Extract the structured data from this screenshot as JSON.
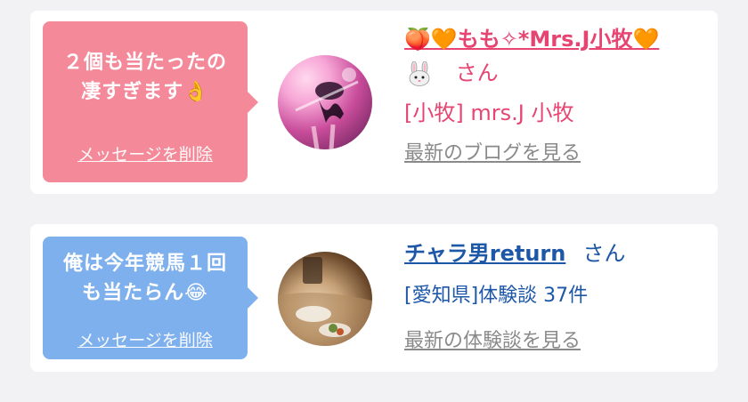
{
  "messages": [
    {
      "bubble_text_line1": "２個も当たったの",
      "bubble_text_line2": "凄すぎます👌",
      "delete_label": "メッセージを削除",
      "user_name": "🍑🧡もも✧*Mrs.J小牧🧡",
      "honorific": "さん",
      "subtitle": "[小牧] mrs.J 小牧",
      "link_label": "最新のブログを見る",
      "bubble_color": "#f4899a",
      "accent_color": "#e64572",
      "avatar_icon": "rabbit-icon"
    },
    {
      "bubble_text_line1": "俺は今年競馬１回",
      "bubble_text_line2": "も当たらん😂",
      "delete_label": "メッセージを削除",
      "user_name": "チャラ男return",
      "honorific": "さん",
      "subtitle": "[愛知県]体験談 37件",
      "link_label": "最新の体験談を見る",
      "bubble_color": "#7fb0ee",
      "accent_color": "#1d57a8"
    }
  ]
}
